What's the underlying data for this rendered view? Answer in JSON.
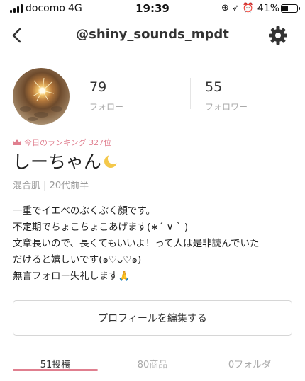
{
  "status_bar": {
    "carrier": "docomo",
    "network": "4G",
    "time": "19:39",
    "battery_percent": "41%",
    "battery_level": 0.41
  },
  "header": {
    "username": "@shiny_sounds_mpdt"
  },
  "profile": {
    "stats": [
      {
        "count": "79",
        "label": "フォロー"
      },
      {
        "count": "55",
        "label": "フォロワー"
      }
    ],
    "ranking": "今日のランキング  327位",
    "display_name": "しーちゃん",
    "meta": "混合肌 | 20代前半",
    "bio": [
      "一重でイエベのぷくぷく顔です。",
      "不定期でちょこちょこあげます(∗´ ∨ ` )",
      "文章長いので、長くてもいいよ！って人は是非読んでいた",
      "だけると嬉しいです(๑♡ᴗ♡๑)",
      "無言フォロー失礼します🙏"
    ],
    "edit_button": "プロフィールを編集する"
  },
  "tabs": [
    {
      "label": "51投稿",
      "active": true
    },
    {
      "label": "80商品",
      "active": false
    },
    {
      "label": "0フォルダ",
      "active": false
    }
  ],
  "colors": {
    "accent_pink": "#e07f8f",
    "moon_yellow": "#f4c84a"
  },
  "icons": [
    "back-chevron-icon",
    "gear-icon",
    "crown-icon",
    "crescent-moon-icon"
  ]
}
